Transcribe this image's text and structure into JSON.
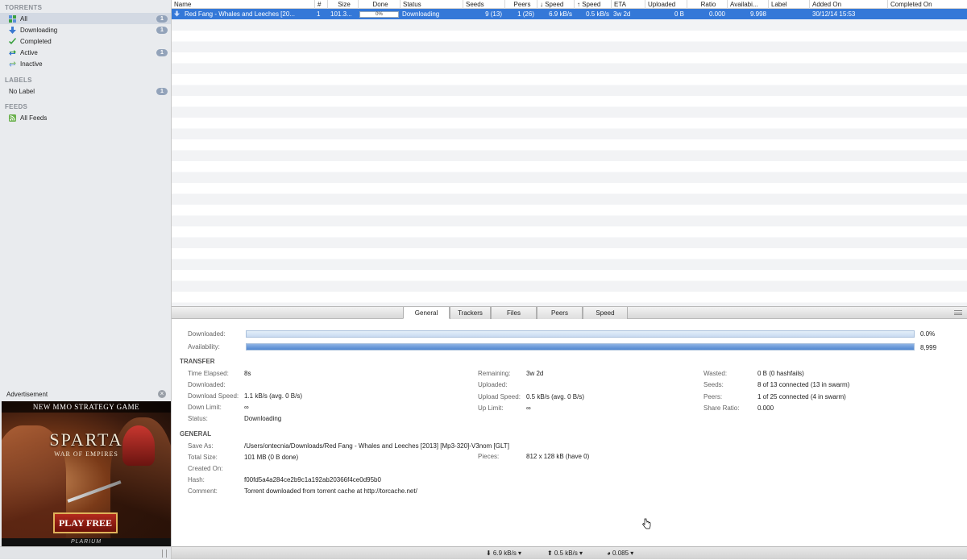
{
  "sidebar": {
    "torrents_header": "TORRENTS",
    "items": [
      {
        "label": "All",
        "badge": "1",
        "icon": "all-icon",
        "color": "#5a8fd8"
      },
      {
        "label": "Downloading",
        "badge": "1",
        "icon": "arrow-down-icon",
        "color": "#3a78d0"
      },
      {
        "label": "Completed",
        "badge": "",
        "icon": "check-icon",
        "color": "#3aa040"
      },
      {
        "label": "Active",
        "badge": "1",
        "icon": "active-icon",
        "color": "#3a78d0"
      },
      {
        "label": "Inactive",
        "badge": "",
        "icon": "inactive-icon",
        "color": "#3aa040"
      }
    ],
    "labels_header": "LABELS",
    "label_items": [
      {
        "label": "No Label",
        "badge": "1"
      }
    ],
    "feeds_header": "FEEDS",
    "feed_items": [
      {
        "label": "All Feeds",
        "icon": "rss-icon",
        "color": "#6ab04c"
      }
    ]
  },
  "ad": {
    "header": "Advertisement",
    "close": "×",
    "top_text": "NEW MMO STRATEGY GAME",
    "title": "SPARTA",
    "subtitle": "WAR OF EMPIRES",
    "button": "PLAY FREE",
    "brand": "PLARIUM"
  },
  "table": {
    "columns": [
      "Name",
      "#",
      "Size",
      "Done",
      "Status",
      "Seeds",
      "Peers",
      "↓ Speed",
      "↑ Speed",
      "ETA",
      "Uploaded",
      "Ratio",
      "Availabi...",
      "Label",
      "Added On",
      "Completed On"
    ],
    "rows": [
      {
        "name": "Red Fang - Whales and Leeches [20...",
        "num": "1",
        "size": "101.3...",
        "done": "0%",
        "done_fraction": 0,
        "status": "Downloading",
        "seeds": "9 (13)",
        "peers": "1 (26)",
        "down_speed": "6.9 kB/s",
        "up_speed": "0.5 kB/s",
        "eta": "3w 2d",
        "uploaded": "0 B",
        "ratio": "0.000",
        "availability": "9.998",
        "label": "",
        "added_on": "30/12/14 15:53",
        "completed_on": ""
      }
    ]
  },
  "tabs": [
    "General",
    "Trackers",
    "Files",
    "Peers",
    "Speed"
  ],
  "general": {
    "downloaded_label": "Downloaded:",
    "downloaded_pct": "0.0%",
    "availability_label": "Availability:",
    "availability_val": "8,999",
    "transfer_header": "TRANSFER",
    "col1": [
      {
        "label": "Time Elapsed:",
        "value": "8s"
      },
      {
        "label": "Downloaded:",
        "value": ""
      },
      {
        "label": "Download Speed:",
        "value": "1.1 kB/s (avg. 0 B/s)"
      },
      {
        "label": "Down Limit:",
        "value": "∞"
      },
      {
        "label": "Status:",
        "value": "Downloading"
      }
    ],
    "col2": [
      {
        "label": "Remaining:",
        "value": "3w 2d"
      },
      {
        "label": "Uploaded:",
        "value": ""
      },
      {
        "label": "Upload Speed:",
        "value": "0.5 kB/s (avg. 0 B/s)"
      },
      {
        "label": "Up Limit:",
        "value": "∞"
      }
    ],
    "col3": [
      {
        "label": "Wasted:",
        "value": "0 B (0 hashfails)"
      },
      {
        "label": "Seeds:",
        "value": "8 of 13 connected (13 in swarm)"
      },
      {
        "label": "Peers:",
        "value": "1 of 25 connected (4 in swarm)"
      },
      {
        "label": "Share Ratio:",
        "value": "0.000"
      }
    ],
    "general_header": "GENERAL",
    "save_as_label": "Save As:",
    "save_as": "/Users/ontecnia/Downloads/Red Fang - Whales and Leeches [2013] [Mp3-320]-V3nom [GLT]",
    "total_size_label": "Total Size:",
    "total_size": "101 MB (0 B done)",
    "pieces_label": "Pieces:",
    "pieces": "812 x 128 kB (have 0)",
    "created_on_label": "Created On:",
    "created_on": "",
    "hash_label": "Hash:",
    "hash": "f00fd5a4a284ce2b9c1a192ab20366f4ce0d95b0",
    "comment_label": "Comment:",
    "comment": "Torrent downloaded from torrent cache at http://torcache.net/"
  },
  "statusbar": {
    "down": "⬇ 6.9 kB/s ▾",
    "up": "⬆ 0.5 kB/s ▾",
    "ratio": "◕ 0.085 ▾"
  }
}
